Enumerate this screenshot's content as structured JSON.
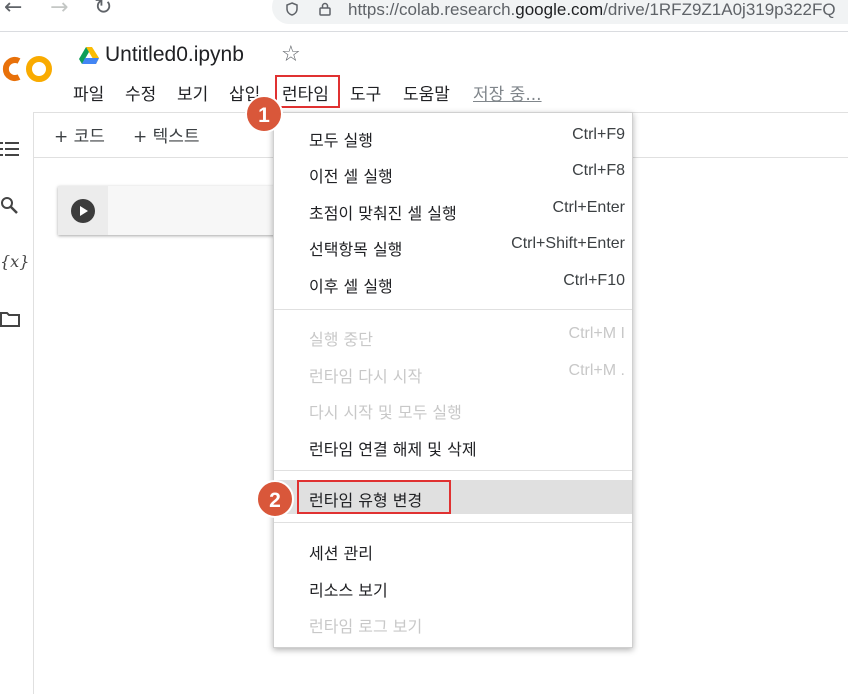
{
  "browser": {
    "url_prefix": "https://colab.research.",
    "url_domain": "google.com",
    "url_suffix": "/drive/1RFZ9Z1A0j319p322FQ"
  },
  "header": {
    "notebook_title": "Untitled0.ipynb",
    "menu": [
      "파일",
      "수정",
      "보기",
      "삽입",
      "런타임",
      "도구",
      "도움말"
    ],
    "status": "저장 중..."
  },
  "toolbar": {
    "add_code": "+ 코드",
    "add_text": "+ 텍스트"
  },
  "runtime_menu": {
    "items": [
      {
        "label": "모두 실행",
        "shortcut": "Ctrl+F9",
        "enabled": true
      },
      {
        "label": "이전 셀 실행",
        "shortcut": "Ctrl+F8",
        "enabled": true
      },
      {
        "label": "초점이 맞춰진 셀 실행",
        "shortcut": "Ctrl+Enter",
        "enabled": true
      },
      {
        "label": "선택항목 실행",
        "shortcut": "Ctrl+Shift+Enter",
        "enabled": true
      },
      {
        "label": "이후 셀 실행",
        "shortcut": "Ctrl+F10",
        "enabled": true
      },
      {
        "label": "실행 중단",
        "shortcut": "Ctrl+M I",
        "enabled": false
      },
      {
        "label": "런타임 다시 시작",
        "shortcut": "Ctrl+M .",
        "enabled": false
      },
      {
        "label": "다시 시작 및 모두 실행",
        "shortcut": "",
        "enabled": false
      },
      {
        "label": "런타임 연결 해제 및 삭제",
        "shortcut": "",
        "enabled": true
      },
      {
        "label": "런타임 유형 변경",
        "shortcut": "",
        "enabled": true
      },
      {
        "label": "세션 관리",
        "shortcut": "",
        "enabled": true
      },
      {
        "label": "리소스 보기",
        "shortcut": "",
        "enabled": true
      },
      {
        "label": "런타임 로그 보기",
        "shortcut": "",
        "enabled": false
      }
    ]
  },
  "annotations": {
    "step1": "1",
    "step2": "2"
  },
  "colors": {
    "highlight": "#e03131",
    "badge": "#d9573a",
    "logo_orange": "#f9ab00",
    "logo_dark": "#e8710a"
  }
}
